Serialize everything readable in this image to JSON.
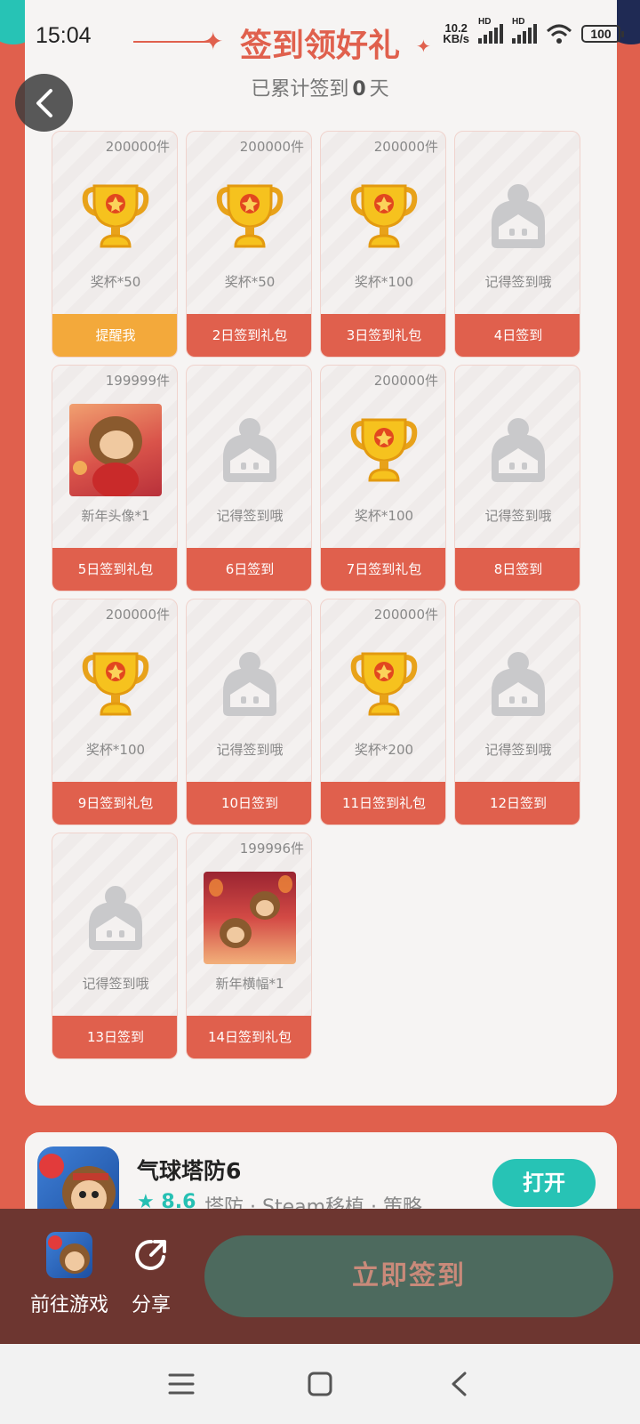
{
  "status_bar": {
    "time": "15:04",
    "net_speed_value": "10.2",
    "net_speed_unit": "KB/s",
    "signal1_label": "HD",
    "signal2_label": "HD",
    "battery": "100"
  },
  "header": {
    "title": "签到领好礼",
    "subtitle_prefix": "已累计签到",
    "days_count": "0",
    "subtitle_suffix": "天"
  },
  "colors": {
    "accent": "#e0604d",
    "remind": "#f3a93b",
    "teal": "#27c3b5",
    "card": "#f6f4f3"
  },
  "rewards": [
    {
      "count": "200000件",
      "icon": "trophy-icon",
      "label": "奖杯*50",
      "day": "提醒我",
      "remind": true
    },
    {
      "count": "200000件",
      "icon": "trophy-icon",
      "label": "奖杯*50",
      "day": "2日签到礼包"
    },
    {
      "count": "200000件",
      "icon": "trophy-icon",
      "label": "奖杯*100",
      "day": "3日签到礼包"
    },
    {
      "count": "",
      "icon": "placeholder-icon",
      "label": "记得签到哦",
      "day": "4日签到"
    },
    {
      "count": "199999件",
      "icon": "new-year-avatar-thumb",
      "label": "新年头像*1",
      "day": "5日签到礼包"
    },
    {
      "count": "",
      "icon": "placeholder-icon",
      "label": "记得签到哦",
      "day": "6日签到"
    },
    {
      "count": "200000件",
      "icon": "trophy-icon",
      "label": "奖杯*100",
      "day": "7日签到礼包"
    },
    {
      "count": "",
      "icon": "placeholder-icon",
      "label": "记得签到哦",
      "day": "8日签到"
    },
    {
      "count": "200000件",
      "icon": "trophy-icon",
      "label": "奖杯*100",
      "day": "9日签到礼包"
    },
    {
      "count": "",
      "icon": "placeholder-icon",
      "label": "记得签到哦",
      "day": "10日签到"
    },
    {
      "count": "200000件",
      "icon": "trophy-icon",
      "label": "奖杯*200",
      "day": "11日签到礼包"
    },
    {
      "count": "",
      "icon": "placeholder-icon",
      "label": "记得签到哦",
      "day": "12日签到"
    },
    {
      "count": "",
      "icon": "placeholder-icon",
      "label": "记得签到哦",
      "day": "13日签到"
    },
    {
      "count": "199996件",
      "icon": "new-year-banner-thumb",
      "label": "新年横幅*1",
      "day": "14日签到礼包"
    }
  ],
  "game": {
    "title": "气球塔防6",
    "rating": "8.6",
    "tags": "塔防 · Steam移植 · 策略",
    "open_label": "打开"
  },
  "bottom_bar": {
    "goto_game_label": "前往游戏",
    "share_label": "分享",
    "signin_label": "立即签到"
  }
}
